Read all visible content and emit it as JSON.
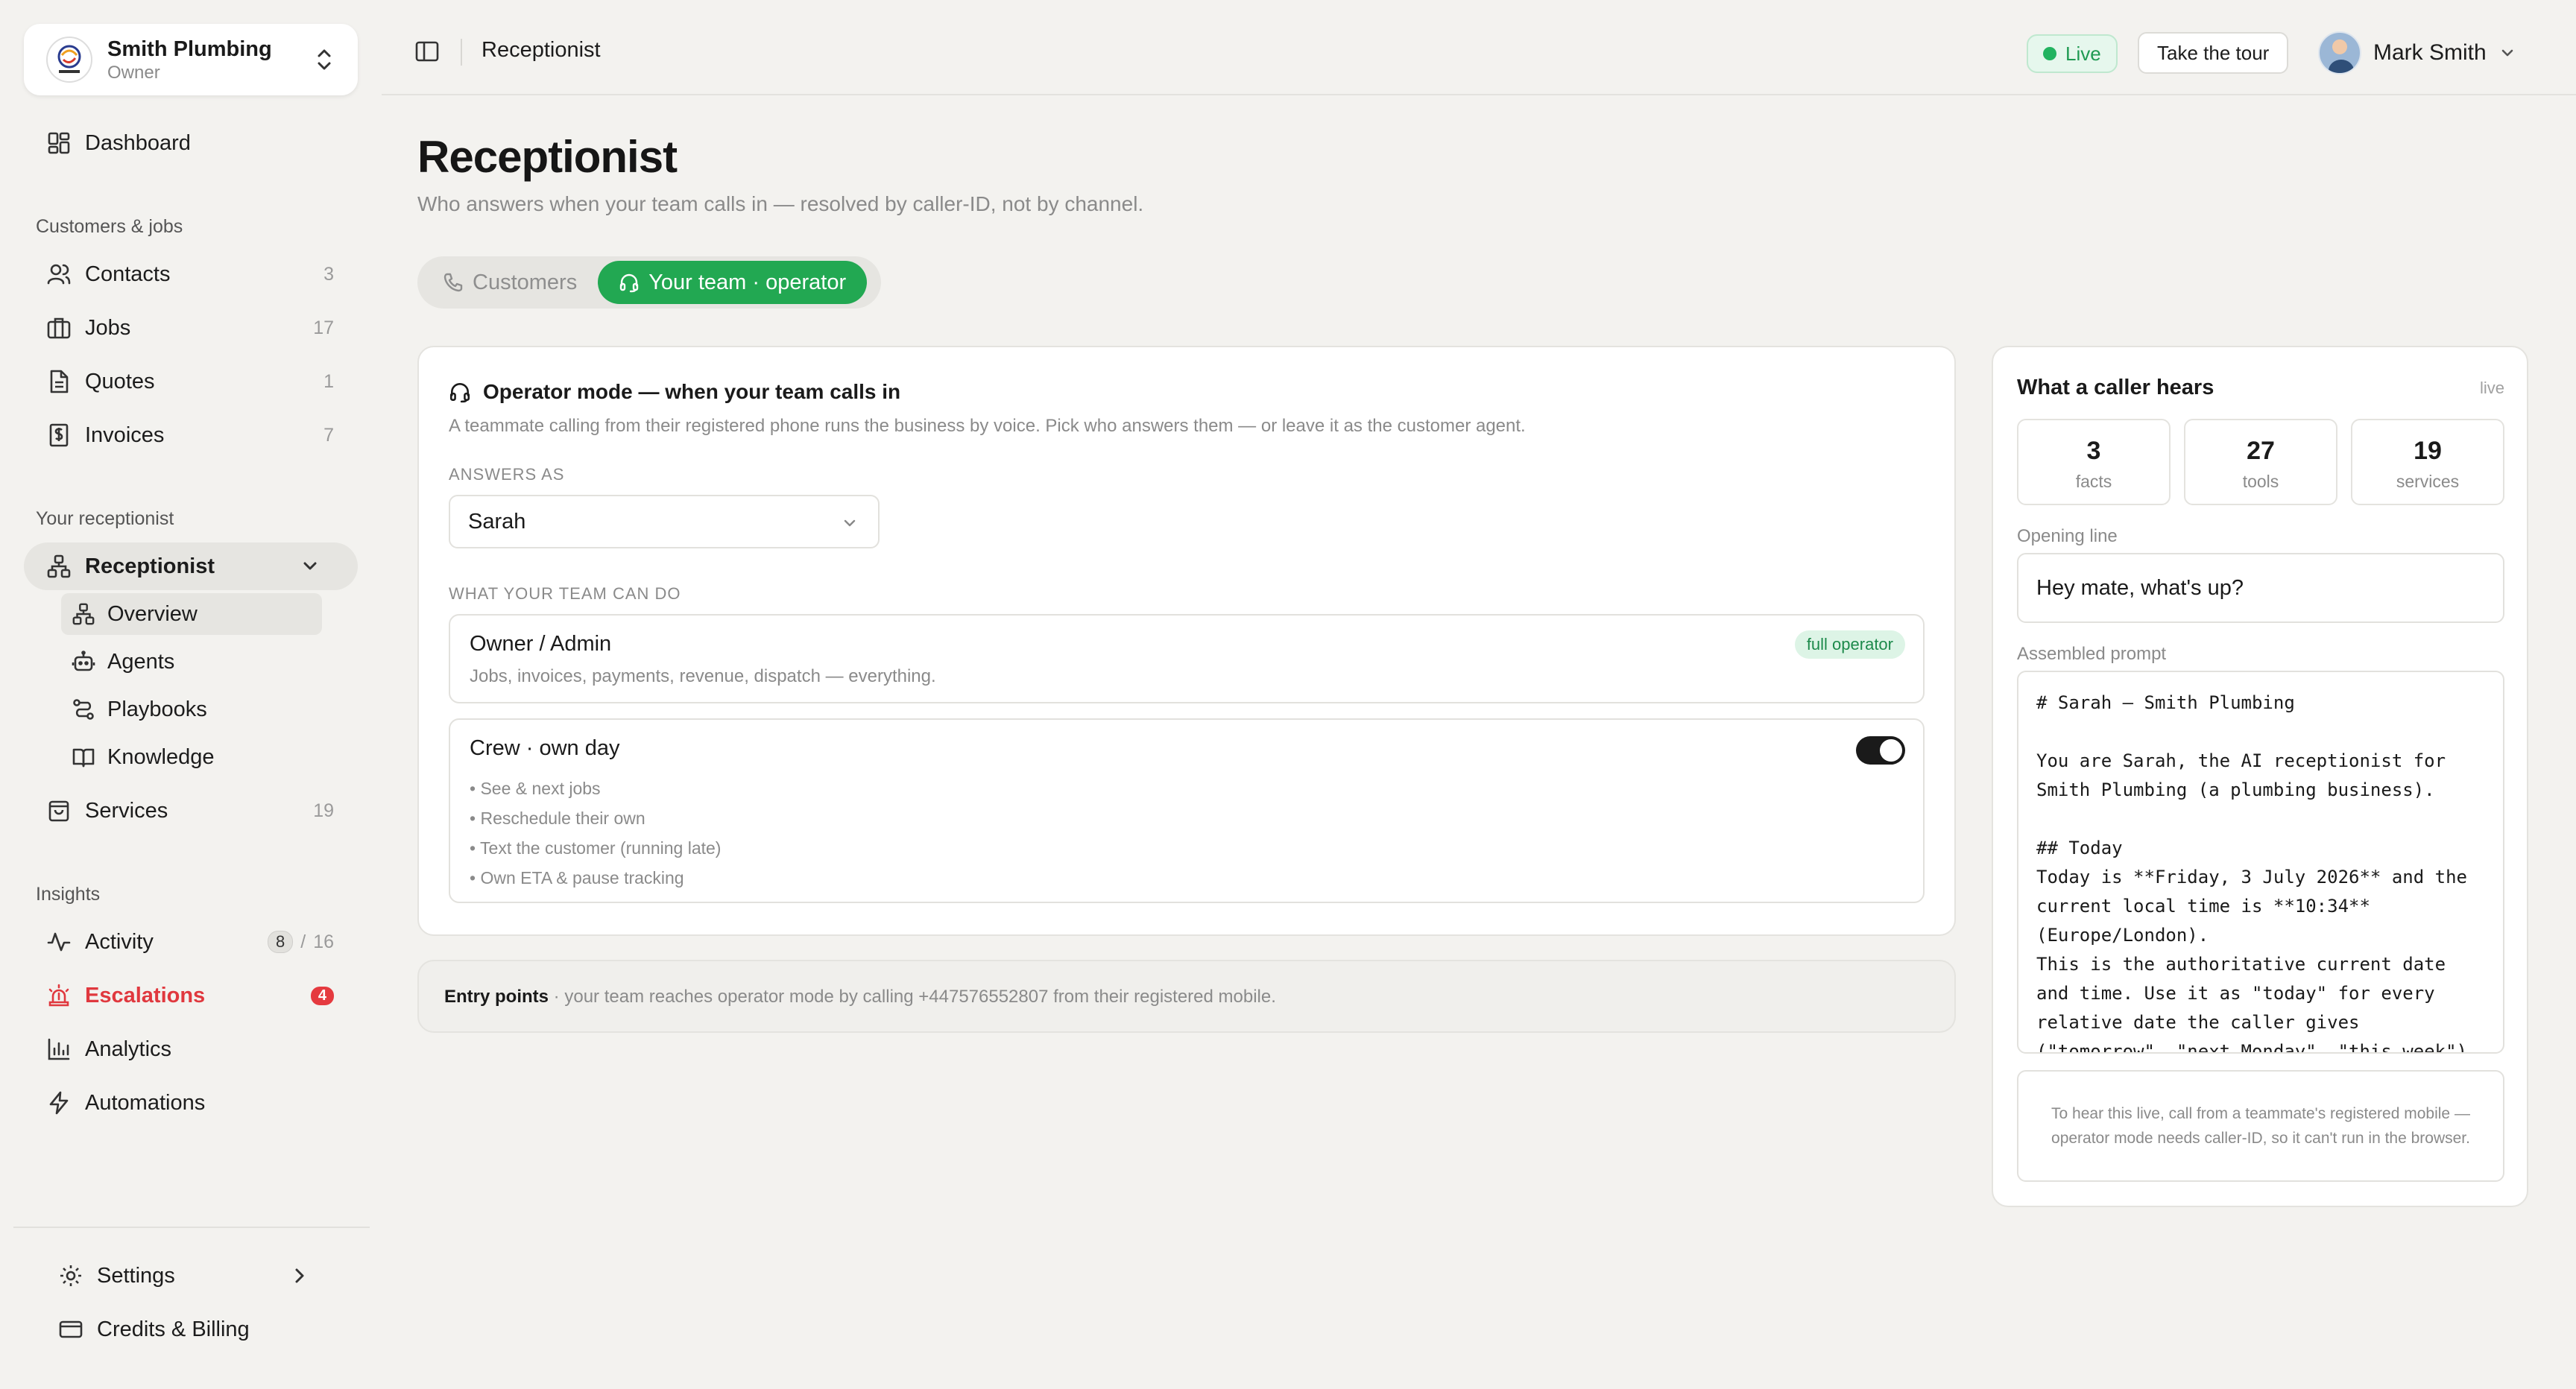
{
  "brand": {
    "name": "Smith Plumbing",
    "role": "Owner",
    "logo_text": "COMPANY"
  },
  "sidebar": {
    "dashboard": "Dashboard",
    "section_customers": "Customers & jobs",
    "contacts": {
      "label": "Contacts",
      "count": "3"
    },
    "jobs": {
      "label": "Jobs",
      "count": "17"
    },
    "quotes": {
      "label": "Quotes",
      "count": "1"
    },
    "invoices": {
      "label": "Invoices",
      "count": "7"
    },
    "section_receptionist": "Your receptionist",
    "receptionist": "Receptionist",
    "sub": {
      "overview": "Overview",
      "agents": "Agents",
      "playbooks": "Playbooks",
      "knowledge": "Knowledge"
    },
    "services": {
      "label": "Services",
      "count": "19"
    },
    "section_insights": "Insights",
    "activity": {
      "label": "Activity",
      "new": "8",
      "sep": "/",
      "total": "16"
    },
    "escalations": {
      "label": "Escalations",
      "count": "4"
    },
    "analytics": "Analytics",
    "automations": "Automations",
    "settings": "Settings",
    "billing": "Credits & Billing"
  },
  "topbar": {
    "breadcrumb": "Receptionist",
    "live": "Live",
    "tour": "Take the tour",
    "user": "Mark Smith"
  },
  "page": {
    "title": "Receptionist",
    "subtitle": "Who answers when your team calls in — resolved by caller-ID, not by channel.",
    "tabs": {
      "customers": "Customers",
      "team": "Your team · operator"
    }
  },
  "operator": {
    "title": "Operator mode — when your team calls in",
    "description": "A teammate calling from their registered phone runs the business by voice. Pick who answers them — or leave it as the customer agent.",
    "answers_as_label": "ANSWERS AS",
    "answers_as_value": "Sarah",
    "team_can_do_label": "WHAT YOUR TEAM CAN DO",
    "owner": {
      "title": "Owner / Admin",
      "description": "Jobs, invoices, payments, revenue, dispatch — everything.",
      "badge": "full operator"
    },
    "crew": {
      "title": "Crew · own day",
      "enabled": true,
      "bullets": [
        "See & next jobs",
        "Reschedule their own",
        "Text the customer (running late)",
        "Own ETA & pause tracking"
      ]
    }
  },
  "entry": {
    "label": "Entry points",
    "text": " · your team reaches operator mode by calling +447576552807 from their registered mobile."
  },
  "hears": {
    "title": "What a caller hears",
    "live": "live",
    "stats": [
      {
        "num": "3",
        "label": "facts"
      },
      {
        "num": "27",
        "label": "tools"
      },
      {
        "num": "19",
        "label": "services"
      }
    ],
    "opening_label": "Opening line",
    "opening": "Hey mate, what's up?",
    "prompt_label": "Assembled prompt",
    "prompt": "# Sarah — Smith Plumbing\n\nYou are Sarah, the AI receptionist for Smith Plumbing (a plumbing business).\n\n## Today\nToday is **Friday, 3 July 2026** and the current local time is **10:34** (Europe/London).\nThis is the authoritative current date and time. Use it as \"today\" for every relative date the caller gives (\"tomorrow\", \"next Monday\", \"this week\")",
    "hint": "To hear this live, call from a teammate's registered mobile — operator mode needs caller-ID, so it can't run in the browser."
  },
  "colors": {
    "accent": "#22a852",
    "danger": "#e53a3f",
    "live": "#22b360"
  }
}
